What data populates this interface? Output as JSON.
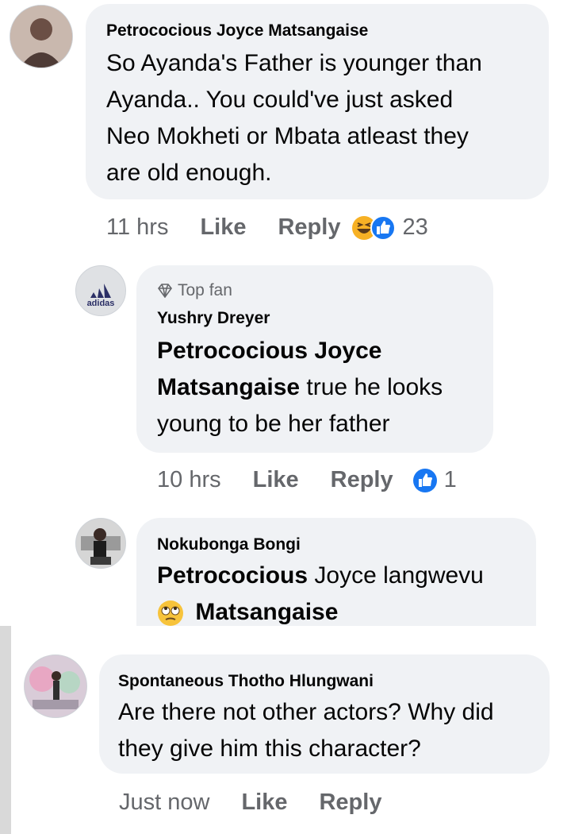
{
  "comments": [
    {
      "author": "Petrococious Joyce Matsangaise",
      "lines": [
        "So Ayanda's Father is younger than",
        "Ayanda.. You could've just asked",
        "Neo Mokheti or Mbata atleast they",
        "are old enough."
      ],
      "time": "11 hrs",
      "like": "Like",
      "reply": "Reply",
      "reaction_count": "23"
    },
    {
      "badge": "Top fan",
      "author": "Yushry Dreyer",
      "avatar_text": "adidas",
      "mention_line1": "Petrococious Joyce",
      "mention_line2": "Matsangaise",
      "line2_rest": " true he looks",
      "line3": "young to be her father",
      "time": "10 hrs",
      "like": "Like",
      "reply": "Reply",
      "reaction_count": "1"
    },
    {
      "author": "Nokubonga Bongi",
      "mention_first": "Petrococious",
      "line1_rest": " Joyce langwevu",
      "mention_second": "Matsangaise"
    },
    {
      "author": "Spontaneous Thotho Hlungwani",
      "lines": [
        "Are there not other actors? Why did",
        "they give him this character?"
      ],
      "time": "Just now",
      "like": "Like",
      "reply": "Reply"
    }
  ],
  "colors": {
    "bubble": "#f0f2f5",
    "meta": "#65676b",
    "like_blue": "#1877f2",
    "haha_yellow": "#f7b125"
  }
}
